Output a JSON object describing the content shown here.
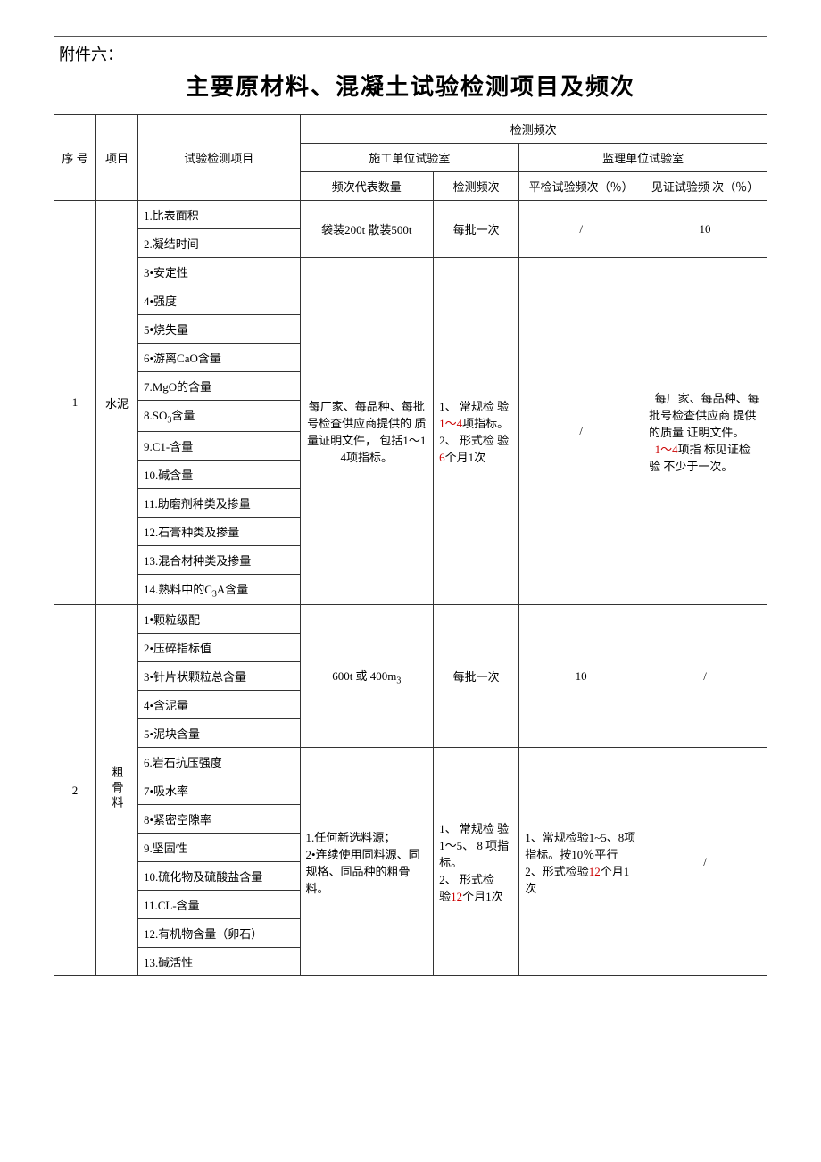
{
  "attachment_label": "附件六：",
  "title": "主要原材料、混凝土试验检测项目及频次",
  "header": {
    "seq": "序 号",
    "project": "项目",
    "test_items": "试验检测项目",
    "freq_group": "检测频次",
    "construction_lab": "施工单位试验室",
    "supervision_lab": "监理单位试验室",
    "rep_qty": "频次代表数量",
    "detect_freq": "检测频次",
    "ping_freq": "平检试验频次（％）",
    "witness_freq": "见证试验频 次（％）"
  },
  "cement": {
    "seq": "1",
    "name": "水泥",
    "items_a": [
      "1.比表面积",
      "2.凝结时间"
    ],
    "items_b": [
      "3•安定性",
      "4•强度",
      "5•烧失量",
      "6•游离CaO含量",
      "7.MgO的含量"
    ],
    "items_c_label": "8.SO",
    "items_c_sub": "3",
    "items_c_tail": "含量",
    "items_d": [
      "9.C1-含量",
      "10.碱含量",
      "11.助磨剂种类及掺量",
      "12.石膏种类及掺量",
      "13.混合材种类及掺量"
    ],
    "item14_a": "14.熟料中的C",
    "item14_sub": "3",
    "item14_b": "A含量",
    "qty_a": "袋装200t 散装500t",
    "freq_a": "每批一次",
    "ping_a": "/",
    "witness_a": "10",
    "qty_b_pre": "每厂家、每品种、每批号检查供应商提供的 质量证明文件， 包括1～14项指标。",
    "freq_b_1": "1、 常规检 验",
    "freq_b_1_red": "1～4",
    "freq_b_1_tail": "项指标。",
    "freq_b_2": "2、 形式检 验",
    "freq_b_2_red": "6",
    "freq_b_2_tail": "个月1次",
    "ping_b": "/",
    "witness_b_1": "每厂家、每品种、每批号检查供应商 提供的质量 证明文件。",
    "witness_b_red": "1～4",
    "witness_b_2": "项指 标见证检验 不少于一次。"
  },
  "coarse": {
    "seq": "2",
    "name": "粗骨料",
    "items_a": [
      "1•颗粒级配",
      "2•压碎指标值"
    ],
    "item3_a": "3•针片状颗粒总含量",
    "items_a2": [
      "4•含泥量",
      "5•泥块含量"
    ],
    "items_b": [
      "6.岩石抗压强度",
      "7•吸水率",
      "8•紧密空隙率",
      "9.坚固性",
      "10.硫化物及硫酸盐含量",
      "11.CL-含量",
      "12.有机物含量（卵石）",
      "13.碱活性"
    ],
    "qty_a_1": "600t 或  400m",
    "qty_a_sub": "3",
    "freq_a": "每批一次",
    "ping_a": "10",
    "witness_a": "/",
    "qty_b": "1.任何新选料源；\n2•连续使用同料源、同规格、同品种的粗骨料。",
    "freq_b_1": "1、 常规检 验1～5、 8 项指标。",
    "freq_b_2a": "2、 形式检",
    "freq_b_2b": "验",
    "freq_b_2_red": "12",
    "freq_b_2_tail": "个月1次",
    "ping_b_1": "1、常规检验1~5、8项指标。按10％平行",
    "ping_b_2a": "2、形式检验",
    "ping_b_red": "12",
    "ping_b_2b": "个月1次",
    "witness_b": "/"
  }
}
